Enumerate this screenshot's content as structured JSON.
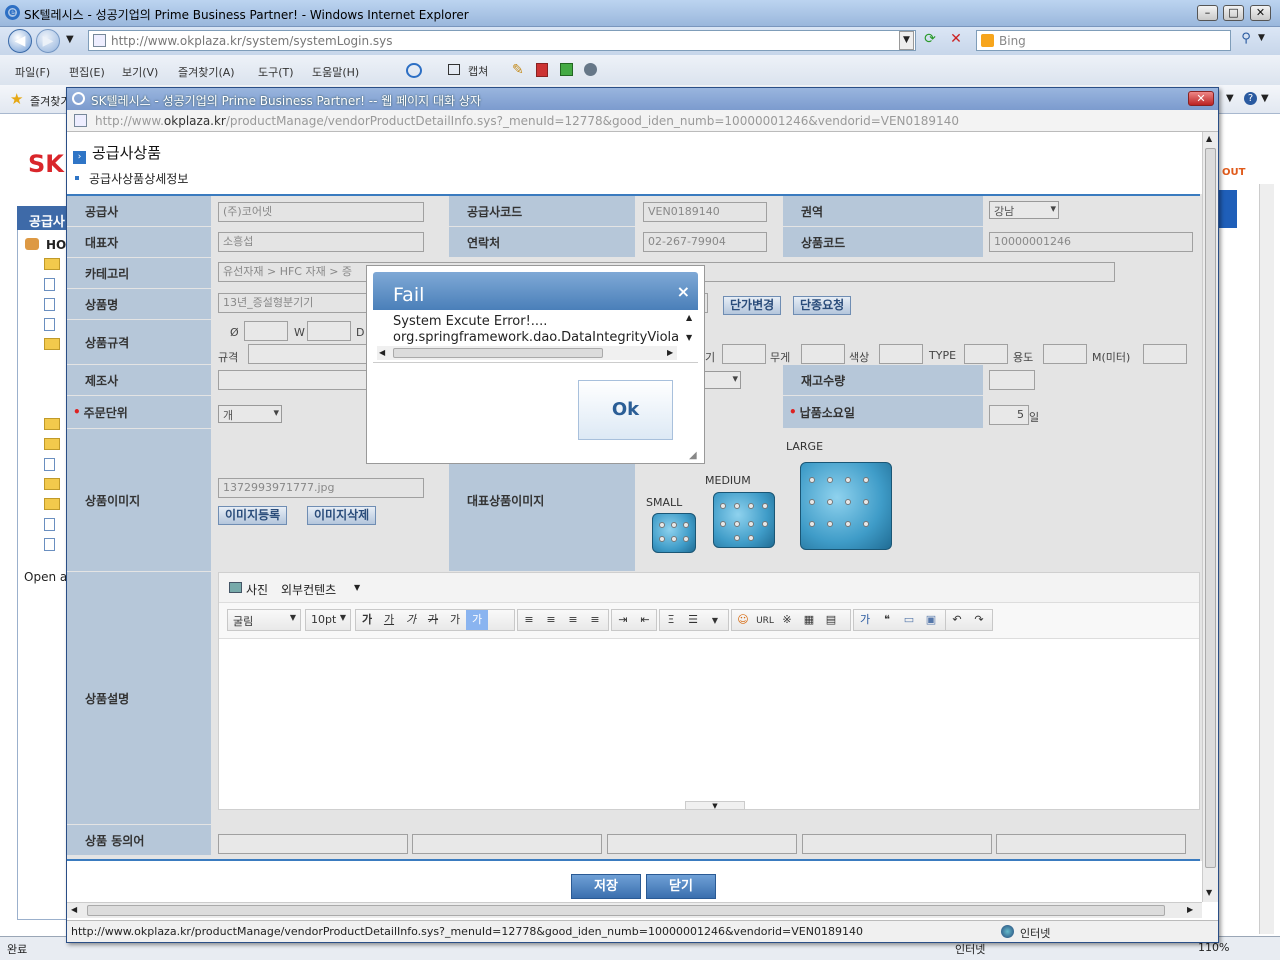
{
  "ie": {
    "title": "SK텔레시스 - 성공기업의 Prime Business Partner! - Windows Internet Explorer",
    "address": "http://www.okplaza.kr/system/systemLogin.sys",
    "search_placeholder": "Bing",
    "menu": [
      "파일(F)",
      "편집(E)",
      "보기(V)",
      "즐겨찾기(A)",
      "도구(T)",
      "도움말(H)"
    ],
    "capture_label": "캡쳐",
    "favorites_label": "즐겨찾기",
    "status_left": "완료",
    "status_zone": "인터넷",
    "zoom": "110%"
  },
  "bgpage": {
    "logo": "SK",
    "nav_label": "공급사",
    "tree_home": "HO",
    "open_label": "Open a",
    "logout": "OUT"
  },
  "popup": {
    "title": "SK텔레시스 - 성공기업의 Prime Business Partner! -- 웹 페이지 대화 상자",
    "url_prefix": "http://www.",
    "url_host": "okplaza.kr",
    "url_rest": "/productManage/vendorProductDetailInfo.sys?_menuId=12778&good_iden_numb=10000001246&vendorid=VEN0189140",
    "status_url": "http://www.okplaza.kr/productManage/vendorProductDetailInfo.sys?_menuId=12778&good_iden_numb=10000001246&vendorid=VEN0189140",
    "status_zone": "인터넷"
  },
  "form": {
    "page_title": "공급사상품",
    "sub_title": "공급사상품상세정보",
    "labels": {
      "vendor": "공급사",
      "vendor_code": "공급사코드",
      "region": "권역",
      "ceo": "대표자",
      "contact": "연락처",
      "product_code": "상품코드",
      "category": "카테고리",
      "product_name": "상품명",
      "spec": "상품규격",
      "maker": "제조사",
      "stock": "재고수량",
      "order_unit": "주문단위",
      "delivery_days": "납품소요일",
      "product_image": "상품이미지",
      "main_image": "대표상품이미지",
      "description": "상품설명",
      "synonyms": "상품 동의어"
    },
    "values": {
      "vendor": "(주)코어넷",
      "vendor_code": "VEN0189140",
      "region": "강남",
      "ceo": "소흥섭",
      "contact": "02-267-79904",
      "product_code": "10000001246",
      "category": "유선자재 > HFC 자재 > 증",
      "product_name": "13년_증설형분기기",
      "order_unit": "개",
      "delivery_days": "5",
      "delivery_unit": "일",
      "image_file": "1372993971777.jpg"
    },
    "spec_labels": [
      "Ø",
      "W",
      "D",
      "규격",
      "기",
      "무게",
      "색상",
      "TYPE",
      "용도",
      "M(미터)"
    ],
    "buttons": {
      "price_change": "단가변경",
      "discontinue": "단종요청",
      "image_register": "이미지등록",
      "image_delete": "이미지삭제",
      "save": "저장",
      "close": "닫기"
    },
    "image_sizes": {
      "small": "SMALL",
      "medium": "MEDIUM",
      "large": "LARGE"
    },
    "editor": {
      "tab_photo": "사진",
      "tab_external": "외부컨텐츠",
      "font": "굴림",
      "size": "10pt",
      "url_label": "URL"
    }
  },
  "dialog": {
    "title": "Fail",
    "line1": "System Excute Error!....",
    "line2": "org.springframework.dao.DataIntegrityViola",
    "ok": "Ok"
  }
}
